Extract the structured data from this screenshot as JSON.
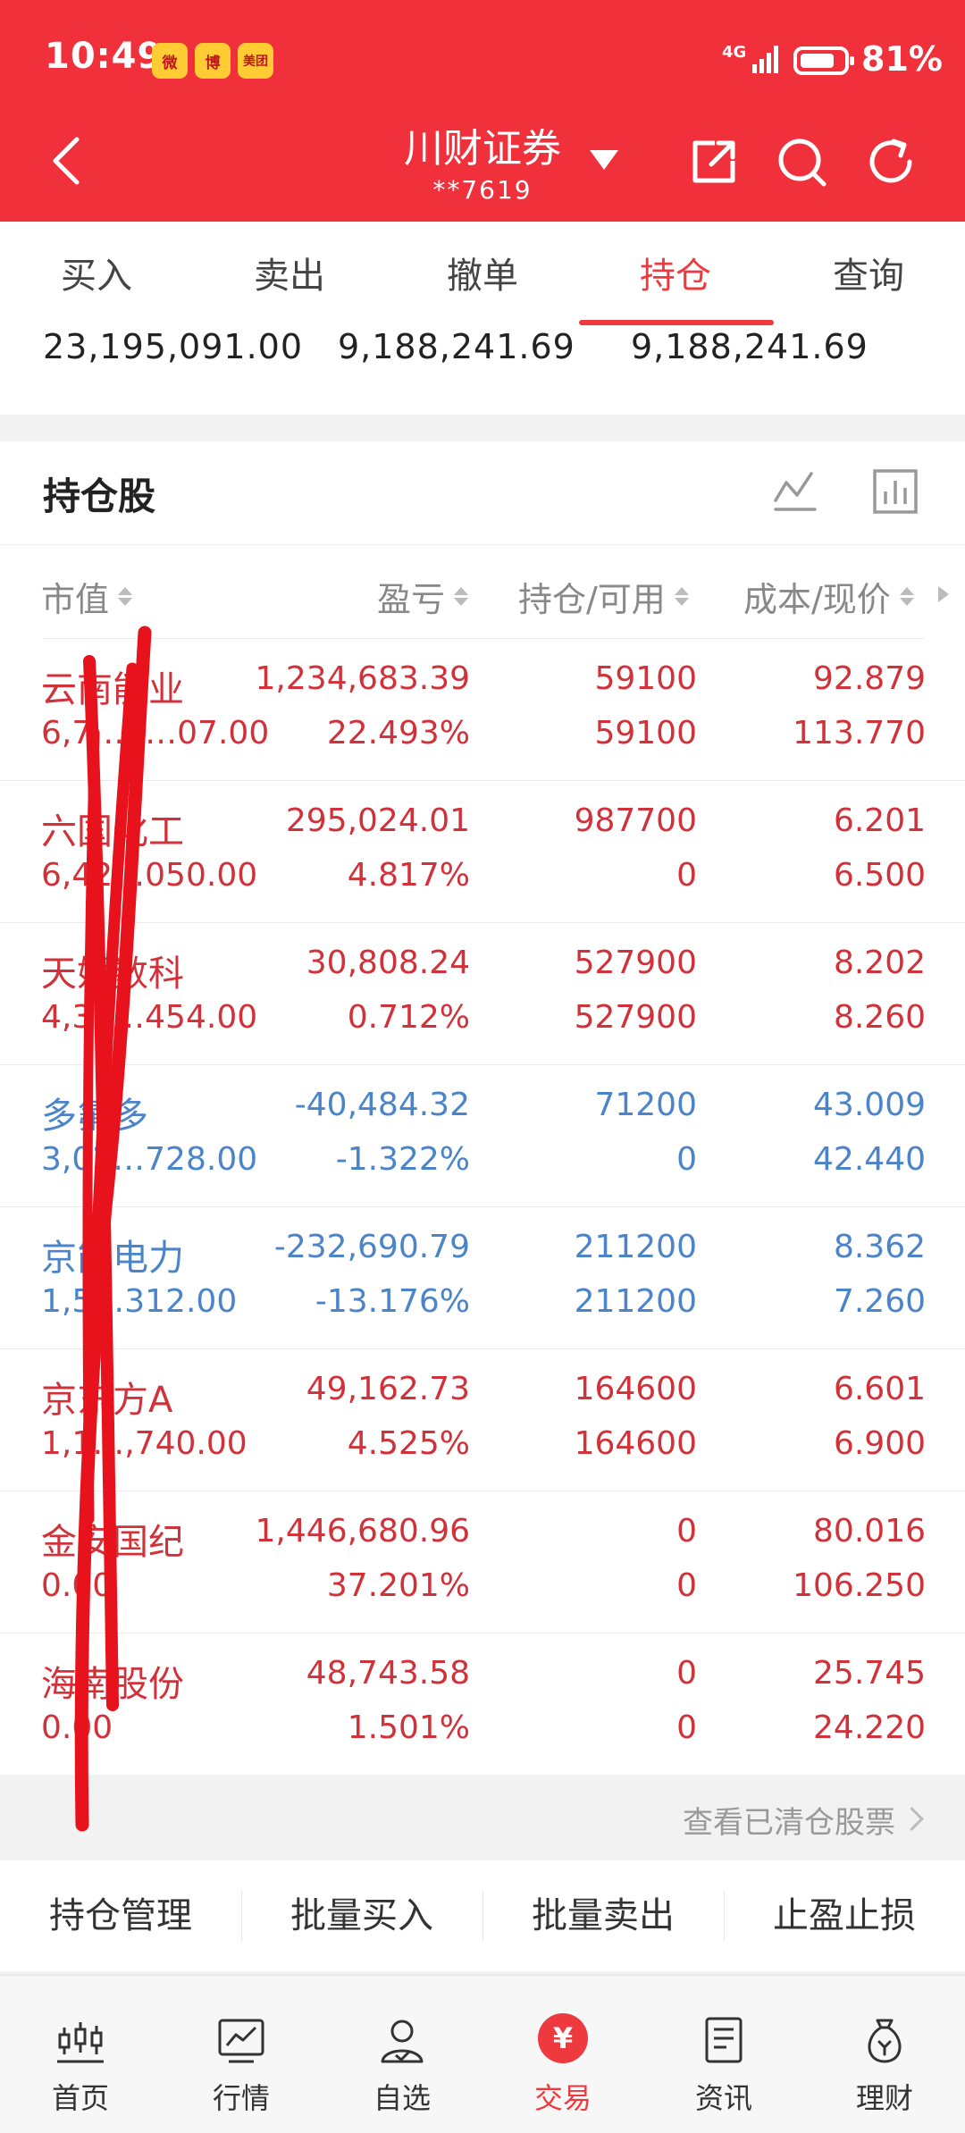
{
  "status_bar": {
    "time": "10:49",
    "app_icons": [
      "微",
      "博",
      "美团"
    ],
    "network": "4G",
    "battery": "81%",
    "battery_level": 0.81
  },
  "header": {
    "title": "川财证券",
    "subtitle": "**7619"
  },
  "tabs": [
    {
      "label": "买入",
      "active": false
    },
    {
      "label": "卖出",
      "active": false
    },
    {
      "label": "撤单",
      "active": false
    },
    {
      "label": "持仓",
      "active": true
    },
    {
      "label": "查询",
      "active": false
    }
  ],
  "summary": {
    "values": [
      "23,195,091.00",
      "9,188,241.69",
      "9,188,241.69"
    ]
  },
  "holdings": {
    "title": "持仓股",
    "columns": [
      "市值",
      "盈亏",
      "持仓/可用",
      "成本/现价"
    ],
    "rows": [
      {
        "name": "云南能业",
        "market_value": "6,7…3…07.00",
        "pnl": "1,234,683.39",
        "pnl_pct": "22.493%",
        "holding": "59100",
        "available": "59100",
        "cost": "92.879",
        "price": "113.770",
        "color": "#d1323a"
      },
      {
        "name": "六国化工",
        "market_value": "6,42…050.00",
        "pnl": "295,024.01",
        "pnl_pct": "4.817%",
        "holding": "987700",
        "available": "0",
        "cost": "6.201",
        "price": "6.500",
        "color": "#d1323a"
      },
      {
        "name": "天娱数科",
        "market_value": "4,36…454.00",
        "pnl": "30,808.24",
        "pnl_pct": "0.712%",
        "holding": "527900",
        "available": "527900",
        "cost": "8.202",
        "price": "8.260",
        "color": "#d1323a"
      },
      {
        "name": "多氟多",
        "market_value": "3,02…728.00",
        "pnl": "-40,484.32",
        "pnl_pct": "-1.322%",
        "holding": "71200",
        "available": "0",
        "cost": "43.009",
        "price": "42.440",
        "color": "#4b84c8"
      },
      {
        "name": "京能电力",
        "market_value": "1,5…312.00",
        "pnl": "-232,690.79",
        "pnl_pct": "-13.176%",
        "holding": "211200",
        "available": "211200",
        "cost": "8.362",
        "price": "7.260",
        "color": "#4b84c8"
      },
      {
        "name": "京东方A",
        "market_value": "1,1…,740.00",
        "pnl": "49,162.73",
        "pnl_pct": "4.525%",
        "holding": "164600",
        "available": "164600",
        "cost": "6.601",
        "price": "6.900",
        "color": "#d1323a"
      },
      {
        "name": "金安国纪",
        "market_value": "0.00",
        "pnl": "1,446,680.96",
        "pnl_pct": "37.201%",
        "holding": "0",
        "available": "0",
        "cost": "80.016",
        "price": "106.250",
        "color": "#d1323a"
      },
      {
        "name": "海南股份",
        "market_value": "0.00",
        "pnl": "48,743.58",
        "pnl_pct": "1.501%",
        "holding": "0",
        "available": "0",
        "cost": "25.745",
        "price": "24.220",
        "color": "#d1323a"
      }
    ]
  },
  "cleared_link": "查看已清仓股票",
  "actions": [
    "持仓管理",
    "批量买入",
    "批量卖出",
    "止盈止损"
  ],
  "bottom_nav": [
    {
      "label": "首页",
      "icon": "candlestick-icon",
      "active": false
    },
    {
      "label": "行情",
      "icon": "chart-icon",
      "active": false
    },
    {
      "label": "自选",
      "icon": "person-check-icon",
      "active": false
    },
    {
      "label": "交易",
      "icon": "yen-icon",
      "active": true
    },
    {
      "label": "资讯",
      "icon": "news-icon",
      "active": false
    },
    {
      "label": "理财",
      "icon": "money-bag-icon",
      "active": false
    }
  ],
  "colors": {
    "brand_red": "#f0313c",
    "gain": "#d1323a",
    "loss": "#4b84c8"
  }
}
